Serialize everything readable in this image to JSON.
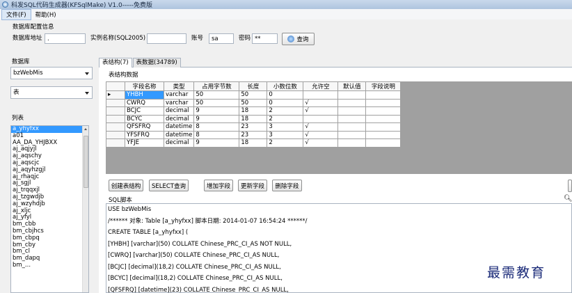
{
  "window": {
    "title": "科发SQL代码生成器(KFSqlMake) V1.0-----免费版"
  },
  "menu": [
    {
      "label": "文件(F)"
    },
    {
      "label": "帮助(H)"
    }
  ],
  "config": {
    "group_label": "数据库配置信息",
    "server_label": "数据库地址",
    "server_value": ".",
    "instance_label": "实例名称(SQL2005)",
    "instance_value": "",
    "account_label": "账号",
    "account_value": "sa",
    "password_label": "密码",
    "password_value": "**",
    "query_button": "查询"
  },
  "left": {
    "database_label": "数据库",
    "database_value": "bzWebMis",
    "object_type_value": "表",
    "list_label": "列表",
    "list_items": [
      "a_yhyfxx",
      "a01",
      "AA_DA_YHJBXX",
      "aj_aqjyjl",
      "aj_aqschy",
      "aj_aqscjc",
      "aj_aqyhzgjl",
      "aj_rhaqjc",
      "aj_sgjl",
      "aj_trqqxjl",
      "aj_tzgwdjb",
      "aj_wzyhdjb",
      "aj_xljc",
      "aj_yfyl",
      "bm_cbb",
      "bm_cbjhcs",
      "bm_cbpq",
      "bm_cby",
      "bm_cl",
      "bm_dapq",
      "bm_..."
    ],
    "selected_index": 0
  },
  "tabs": [
    {
      "label": "表结构(7)",
      "active": true
    },
    {
      "label": "表数据(34789)",
      "active": false
    }
  ],
  "structure": {
    "group_label": "表结构数据",
    "columns": [
      "字段名称",
      "类型",
      "占用字节数",
      "长度",
      "小数位数",
      "允许空",
      "默认值",
      "字段说明"
    ],
    "current_row_marker": "▸",
    "rows": [
      [
        "YHBH",
        "varchar",
        "50",
        "50",
        "0",
        "",
        "",
        ""
      ],
      [
        "CWRQ",
        "varchar",
        "50",
        "50",
        "0",
        "√",
        "",
        ""
      ],
      [
        "BCJC",
        "decimal",
        "9",
        "18",
        "2",
        "√",
        "",
        ""
      ],
      [
        "BCYC",
        "decimal",
        "9",
        "18",
        "2",
        "",
        "",
        ""
      ],
      [
        "QFSFRQ",
        "datetime",
        "8",
        "23",
        "3",
        "√",
        "",
        ""
      ],
      [
        "YFSFRQ",
        "datetime",
        "8",
        "23",
        "3",
        "√",
        "",
        ""
      ],
      [
        "YFJE",
        "decimal",
        "9",
        "18",
        "2",
        "√",
        "",
        ""
      ]
    ]
  },
  "buttons": {
    "create": "创建表结构",
    "select": "SELECT查询",
    "add_field": "增加字段",
    "update_field": "更新字段",
    "delete_field": "删除字段"
  },
  "sql": {
    "group_label": "SQL脚本",
    "lines": [
      "USE bzWebMis",
      "/****** 对象:  Table [a_yhyfxx]    脚本日期: 2014-01-07 16:54:24 ******/",
      "CREATE TABLE [a_yhyfxx] (",
      "[YHBH] [varchar](50) COLLATE Chinese_PRC_CI_AS NOT NULL,",
      "[CWRQ] [varchar](50) COLLATE Chinese_PRC_CI_AS NULL,",
      "[BCJC] [decimal](18,2) COLLATE Chinese_PRC_CI_AS NULL,",
      "[BCYC] [decimal](18,2) COLLATE Chinese_PRC_CI_AS NULL,",
      "[QFSFRQ] [datetime](23) COLLATE Chinese_PRC_CI_AS NULL,"
    ]
  },
  "watermark": "最需教育"
}
